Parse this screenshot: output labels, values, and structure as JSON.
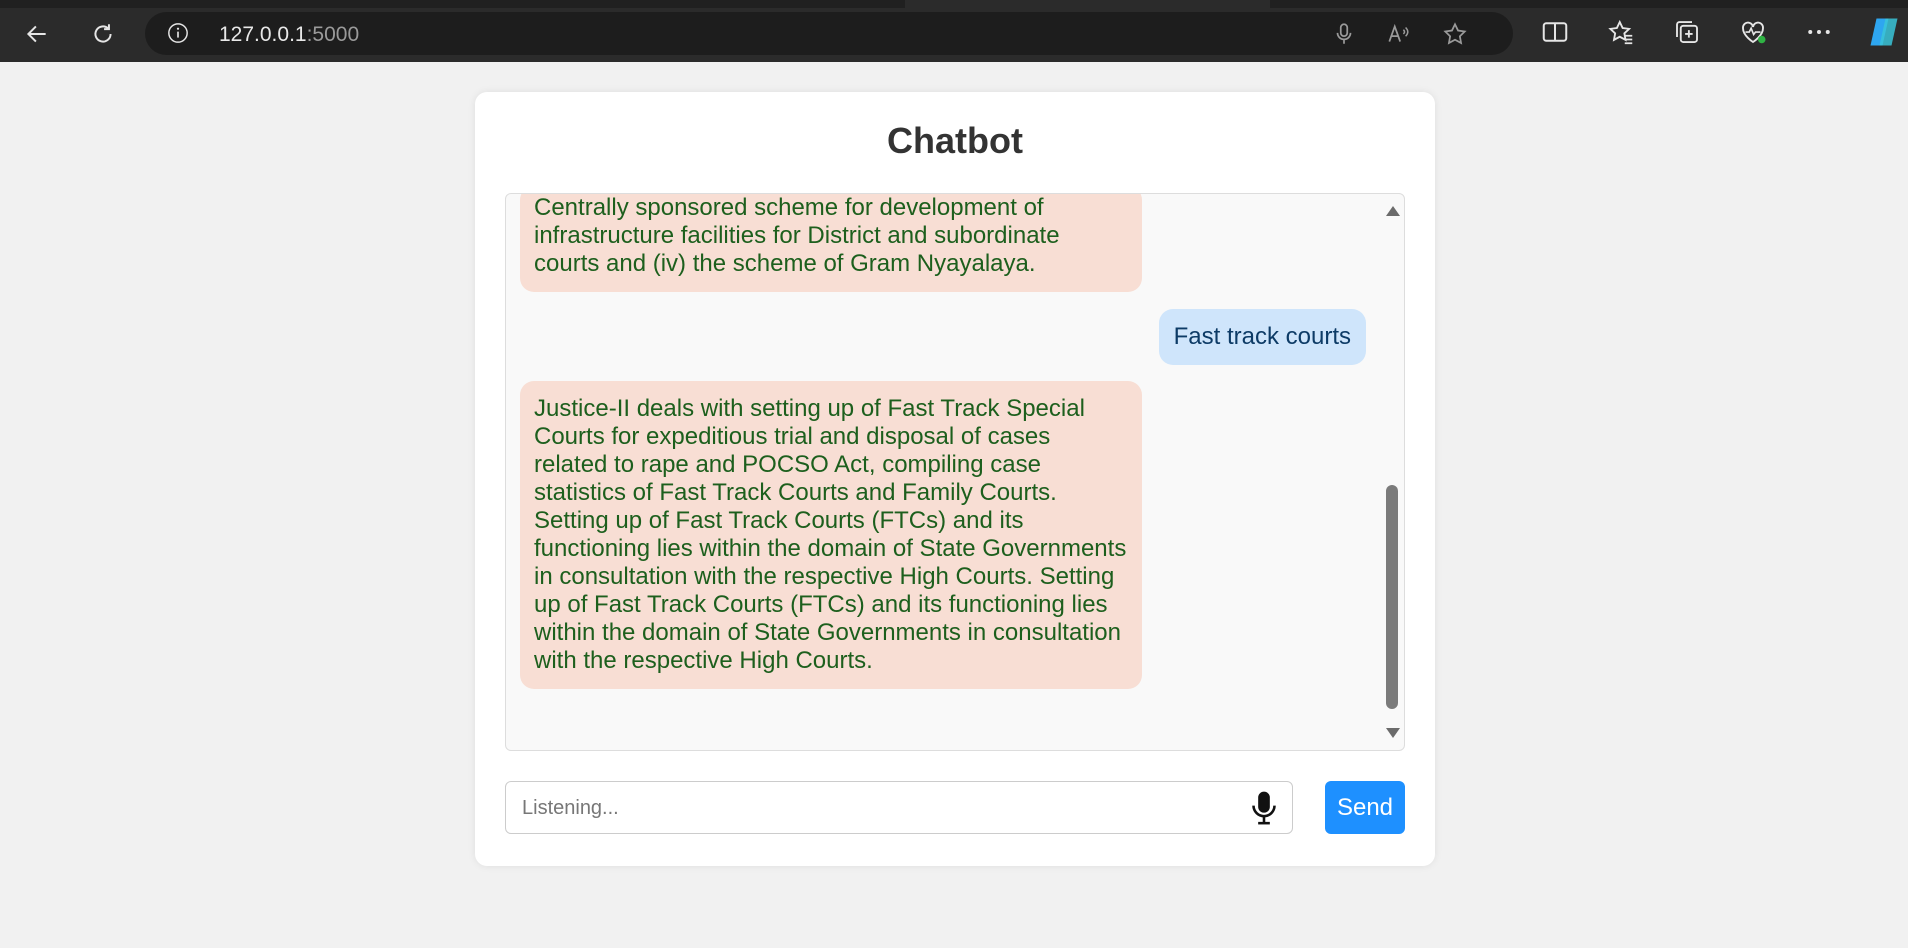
{
  "browser": {
    "url_host": "127.0.0.1",
    "url_port": ":5000"
  },
  "app": {
    "title": "Chatbot"
  },
  "messages": [
    {
      "sender": "bot",
      "text": "Centrally sponsored scheme for development of infrastructure facilities for District and subordinate courts and (iv) the scheme of Gram Nyayalaya."
    },
    {
      "sender": "user",
      "text": "Fast track courts"
    },
    {
      "sender": "bot",
      "text": "Justice-II deals with setting up of Fast Track Special Courts for expeditious trial and disposal of cases related to rape and POCSO Act, compiling case statistics of Fast Track Courts and Family Courts. Setting up of Fast Track Courts (FTCs) and its functioning lies within the domain of State Governments in consultation with the respective High Courts. Setting up of Fast Track Courts (FTCs) and its functioning lies within the domain of State Governments in consultation with the respective High Courts."
    }
  ],
  "composer": {
    "placeholder": "Listening...",
    "send_label": "Send"
  },
  "colors": {
    "bot_bubble": "#f8ded4",
    "bot_text": "#1d5f1d",
    "user_bubble": "#cfe5fb",
    "user_text": "#0d3b66",
    "send_button": "#1e90ff"
  }
}
